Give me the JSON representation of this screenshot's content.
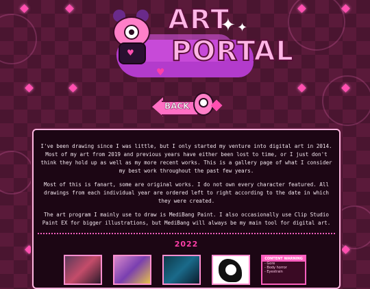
{
  "header": {
    "title_line1": "ART",
    "title_line2": "PORTAL"
  },
  "back_button": {
    "label": "BACK"
  },
  "intro": {
    "paragraphs": [
      "I've been drawing since I was little, but I only started my venture into digital art in 2014. Most of my art from 2019 and previous years have either been lost to time, or I just don't think they hold up as well as my more recent works. This is a gallery page of what I consider my best work throughout the past few years.",
      "Most of this is fanart, some are original works. I do not own every character featured. All drawings from each individual year are ordered left to right according to the date in which they were created.",
      "The art program I mainly use to draw is MediBang Paint. I also occasionally use Clip Studio Paint EX for bigger illustrations, but MediBang will always be my main tool for digital art."
    ]
  },
  "gallery": {
    "year": "2022",
    "content_warning": {
      "title": "CONTENT WARNING",
      "items": [
        "- Gore",
        "- Body horror",
        "- Eyestrain"
      ]
    }
  },
  "colors": {
    "accent": "#ff5fbf",
    "year": "#ff3fa8",
    "background": "#4a1530",
    "panel": "#1c0614"
  }
}
